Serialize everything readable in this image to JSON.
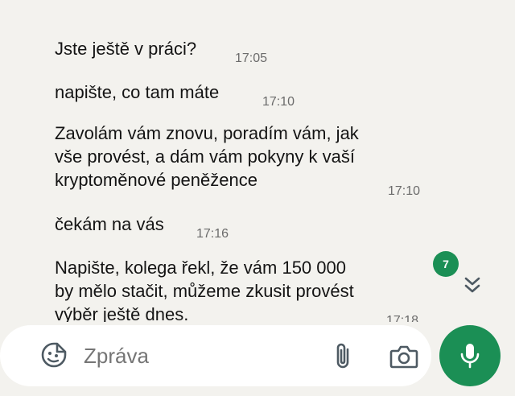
{
  "messages": [
    {
      "text": "Jste ještě v práci?",
      "time": "17:05"
    },
    {
      "text": "napište, co tam máte",
      "time": "17:10"
    },
    {
      "text": "Zavolám vám znovu, poradím vám, jak\nvše provést, a dám vám pokyny k vaší\nkryptoměnové peněžence",
      "time": "17:10"
    },
    {
      "text": "čekám na vás",
      "time": "17:16"
    },
    {
      "text": "Napište, kolega řekl, že vám 150 000\nby mělo stačit, můžeme zkusit provést\nvýběr ještě dnes.",
      "time": "17:18"
    }
  ],
  "scroll": {
    "unread_count": "7"
  },
  "composer": {
    "placeholder": "Zpráva"
  },
  "icons": {
    "emoji": "sticker-emoji-icon",
    "attach": "paperclip-icon",
    "camera": "camera-icon",
    "mic": "microphone-icon",
    "scroll_down": "double-chevron-down-icon"
  },
  "colors": {
    "accent": "#1b8f55",
    "background": "#f3f2ee"
  }
}
